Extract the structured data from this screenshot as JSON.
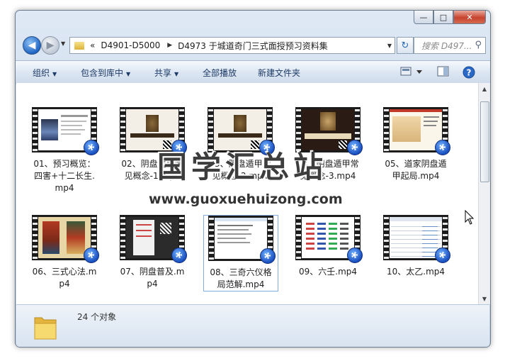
{
  "window": {
    "controls": [
      "—",
      "□",
      "✕"
    ]
  },
  "nav": {
    "address": {
      "root_marker": "«",
      "crumbs": [
        "D4901-D5000",
        "D4973 于城道奇门三式面授预习资料集"
      ]
    },
    "search_placeholder": "搜索 D497...",
    "icons": [
      "back-arrow-icon",
      "forward-arrow-icon",
      "folder-icon",
      "refresh-icon",
      "search-icon"
    ]
  },
  "toolbar": {
    "organize": "组织",
    "include_library": "包含到库中",
    "share": "共享",
    "play_all": "全部播放",
    "new_folder": "新建文件夹"
  },
  "files": [
    {
      "name": "01、预习概览：四害+十二长生.mp4",
      "thumb": "video-thumbnail-person"
    },
    {
      "name": "02、阴盘遁甲常见概念-1.mp4",
      "thumb": "video-thumbnail-title"
    },
    {
      "name": "03、阴盘遁甲常见概念-2.mp4",
      "thumb": "video-thumbnail-title"
    },
    {
      "name": "04、阴盘遁甲常见概念-3.mp4",
      "thumb": "video-thumbnail-title-dark"
    },
    {
      "name": "05、道家阴盘遁甲起局.mp4",
      "thumb": "video-thumbnail-slides"
    },
    {
      "name": "06、三式心法.mp4",
      "thumb": "video-thumbnail-painting"
    },
    {
      "name": "07、阴盘普及.mp4",
      "thumb": "video-thumbnail-dark"
    },
    {
      "name": "08、三奇六仪格局范解.mp4",
      "thumb": "video-thumbnail-document",
      "selected": true
    },
    {
      "name": "09、六壬.mp4",
      "thumb": "video-thumbnail-chart"
    },
    {
      "name": "10、太乙.mp4",
      "thumb": "video-thumbnail-spreadsheet"
    }
  ],
  "status": {
    "count": "24 个对象"
  },
  "watermark": {
    "title": "国学汇总站",
    "url": "www.guoxuehuizong.com"
  },
  "colors": {
    "selection_border": "#84acdd",
    "toolbar_text": "#1e3a66",
    "close_button": "#c7432f"
  }
}
